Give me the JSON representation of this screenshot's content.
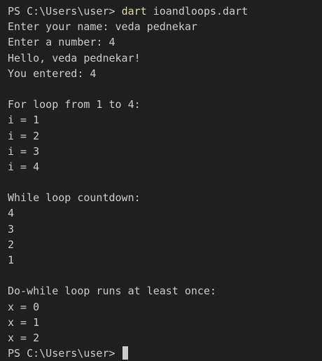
{
  "terminal": {
    "prompt": "PS C:\\Users\\user> ",
    "command_name": "dart",
    "command_args": " ioandloops.dart",
    "output": [
      "Enter your name: veda pednekar",
      "Enter a number: 4",
      "Hello, veda pednekar!",
      "You entered: 4",
      "",
      "For loop from 1 to 4:",
      "i = 1",
      "i = 2",
      "i = 3",
      "i = 4",
      "",
      "While loop countdown:",
      "4",
      "3",
      "2",
      "1",
      "",
      "Do-while loop runs at least once:",
      "x = 0",
      "x = 1",
      "x = 2"
    ],
    "final_prompt": "PS C:\\Users\\user> ",
    "colors": {
      "background": "#1f1f1f",
      "text": "#cccccc",
      "command": "#dcdcaa"
    }
  }
}
